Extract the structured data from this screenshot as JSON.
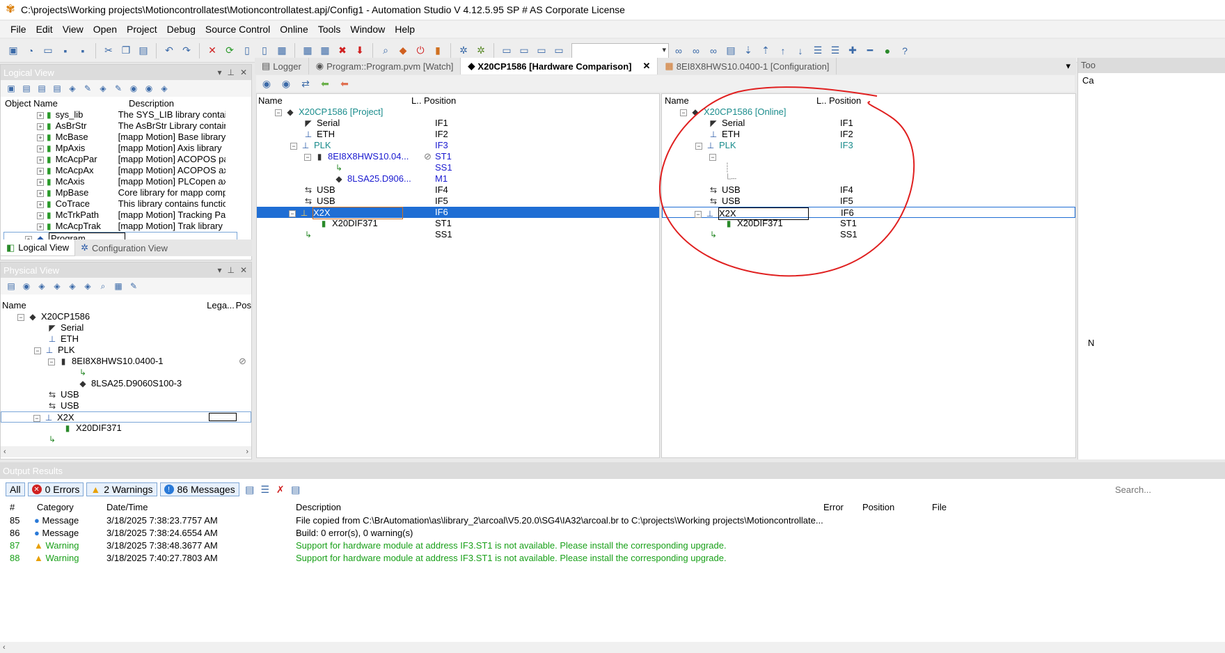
{
  "window": {
    "title": "C:\\projects\\Working projects\\Motioncontrollatest\\Motioncontrollatest.apj/Config1 - Automation Studio V 4.12.5.95 SP # AS Corporate License"
  },
  "menu": [
    "File",
    "Edit",
    "View",
    "Open",
    "Project",
    "Debug",
    "Source Control",
    "Online",
    "Tools",
    "Window",
    "Help"
  ],
  "logical_view": {
    "title": "Logical View",
    "col_name": "Object Name",
    "col_desc": "Description",
    "items": [
      {
        "name": "sys_lib",
        "desc": "The SYS_LIB library contains"
      },
      {
        "name": "AsBrStr",
        "desc": "The AsBrStr Library contains"
      },
      {
        "name": "McBase",
        "desc": "[mapp Motion] Base library"
      },
      {
        "name": "MpAxis",
        "desc": "[mapp Motion] Axis library"
      },
      {
        "name": "McAcpPar",
        "desc": "[mapp Motion] ACOPOS para"
      },
      {
        "name": "McAcpAx",
        "desc": "[mapp Motion] ACOPOS axis"
      },
      {
        "name": "McAxis",
        "desc": "[mapp Motion] PLCopen axis"
      },
      {
        "name": "MpBase",
        "desc": "Core library for mapp compor"
      },
      {
        "name": "CoTrace",
        "desc": "This library contains functiona"
      },
      {
        "name": "McTrkPath",
        "desc": "[mapp Motion] Tracking Path"
      },
      {
        "name": "McAcpTrak",
        "desc": "[mapp Motion] Trak library"
      }
    ],
    "program": "Program",
    "tab_logical": "Logical View",
    "tab_config": "Configuration View"
  },
  "physical_view": {
    "title": "Physical View",
    "col_name": "Name",
    "col_legacy": "Lega...",
    "col_pos": "Pos",
    "root": "X20CP1586",
    "items": [
      "Serial",
      "ETH",
      "PLK",
      "8EI8X8HWS10.0400-1",
      "8LSA25.D9060S100-3",
      "USB",
      "USB",
      "X2X",
      "X20DIF371"
    ]
  },
  "tabs": [
    {
      "label": "Logger"
    },
    {
      "label": "Program::Program.pvm [Watch]"
    },
    {
      "label": "X20CP1586 [Hardware Comparison]"
    },
    {
      "label": "8EI8X8HWS10.0400-1 [Configuration]"
    }
  ],
  "compare_left": {
    "col_name": "Name",
    "col_l": "L..",
    "col_pos": "Position",
    "root": "X20CP1586 [Project]",
    "rows": [
      {
        "name": "Serial",
        "pos": "IF1"
      },
      {
        "name": "ETH",
        "pos": "IF2"
      },
      {
        "name": "PLK",
        "pos": "IF3"
      },
      {
        "name": "8EI8X8HWS10.04...",
        "pos": "ST1"
      },
      {
        "name": "",
        "pos": "SS1"
      },
      {
        "name": "8LSA25.D906...",
        "pos": "M1"
      },
      {
        "name": "USB",
        "pos": "IF4"
      },
      {
        "name": "USB",
        "pos": "IF5"
      },
      {
        "name": "X2X",
        "pos": "IF6"
      },
      {
        "name": "X20DIF371",
        "pos": "ST1"
      },
      {
        "name": "",
        "pos": "SS1"
      }
    ]
  },
  "compare_right": {
    "col_name": "Name",
    "col_l": "L..",
    "col_pos": "Position",
    "root": "X20CP1586 [Online]",
    "rows": [
      {
        "name": "Serial",
        "pos": "IF1"
      },
      {
        "name": "ETH",
        "pos": "IF2"
      },
      {
        "name": "PLK",
        "pos": "IF3"
      },
      {
        "name": "USB",
        "pos": "IF4"
      },
      {
        "name": "USB",
        "pos": "IF5"
      },
      {
        "name": "X2X",
        "pos": "IF6"
      },
      {
        "name": "X20DIF371",
        "pos": "ST1"
      },
      {
        "name": "",
        "pos": "SS1"
      }
    ]
  },
  "output": {
    "title": "Output Results",
    "filter_all": "All",
    "errors": "0 Errors",
    "warnings": "2 Warnings",
    "messages": "86 Messages",
    "search_placeholder": "Search...",
    "columns": [
      "#",
      "Category",
      "Date/Time",
      "Description",
      "Error",
      "Position",
      "File"
    ],
    "rows": [
      {
        "num": "85",
        "cat": "Message",
        "dt": "3/18/2025 7:38:23.7757 AM",
        "desc": "File copied from C:\\BrAutomation\\as\\library_2\\arcoal\\V5.20.0\\SG4\\IA32\\arcoal.br to C:\\projects\\Working projects\\Motioncontrollate..."
      },
      {
        "num": "86",
        "cat": "Message",
        "dt": "3/18/2025 7:38:24.6554 AM",
        "desc": "Build: 0 error(s), 0 warning(s)"
      },
      {
        "num": "87",
        "cat": "Warning",
        "dt": "3/18/2025 7:38:48.3677 AM",
        "desc": "Support for hardware module at address IF3.ST1 is not available. Please install the corresponding upgrade."
      },
      {
        "num": "88",
        "cat": "Warning",
        "dt": "3/18/2025 7:40:27.7803 AM",
        "desc": "Support for hardware module at address IF3.ST1 is not available. Please install the corresponding upgrade."
      }
    ]
  },
  "right_edge": {
    "tab": "Too",
    "c": "Ca",
    "n": "N"
  },
  "annotation_color": "#e02020"
}
